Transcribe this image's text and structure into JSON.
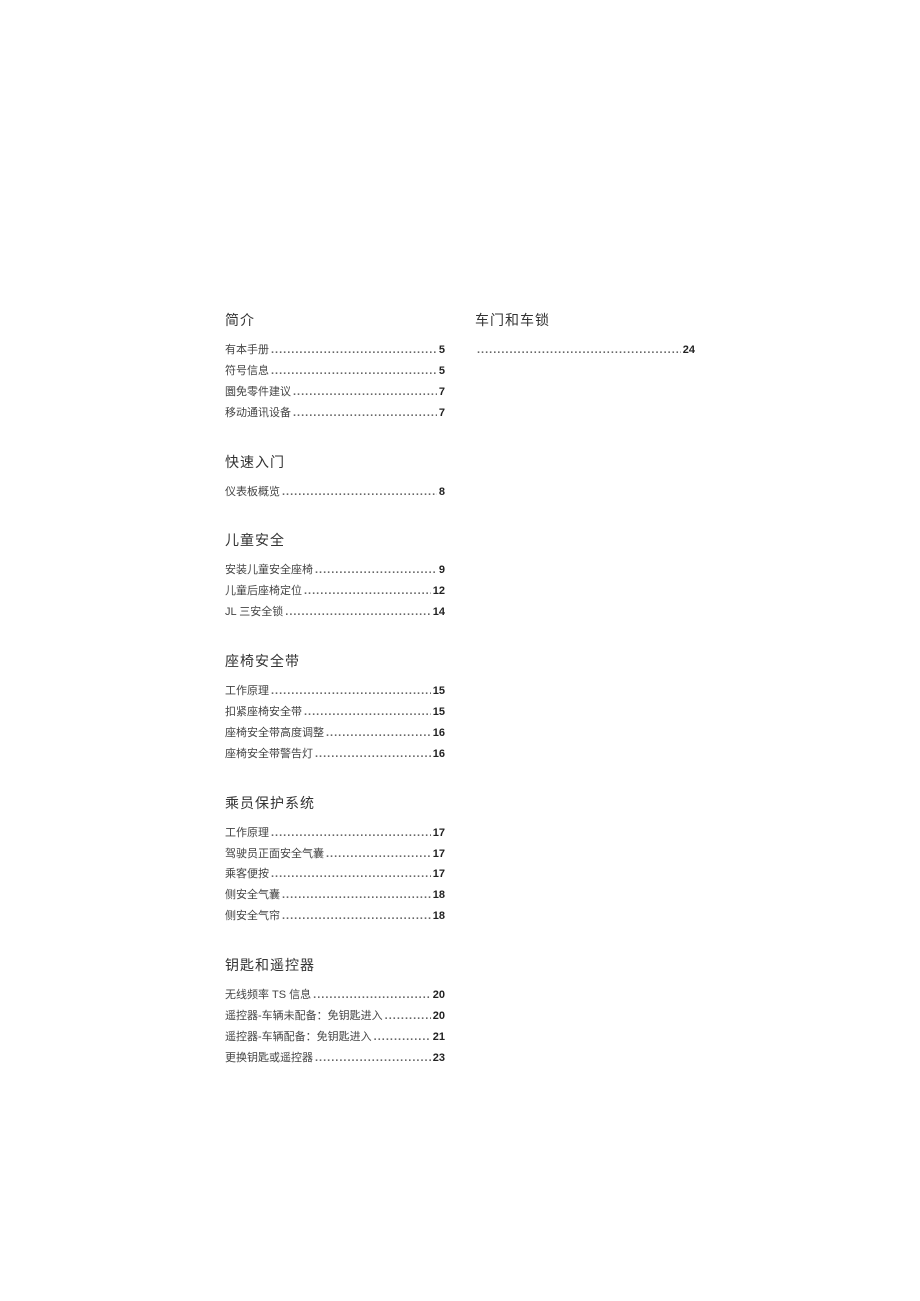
{
  "left_column": [
    {
      "title": "简介",
      "entries": [
        {
          "label": "有本手册",
          "page": "5"
        },
        {
          "label": "符号信息",
          "page": "5"
        },
        {
          "label": "圜免零件建议",
          "page": "7"
        },
        {
          "label": "移动通讯设备",
          "page": "7"
        }
      ]
    },
    {
      "title": "快速入门",
      "entries": [
        {
          "label": "仪表板概览",
          "page": "8"
        }
      ]
    },
    {
      "title": "儿童安全",
      "entries": [
        {
          "label": "安装儿童安全座椅",
          "page": "9"
        },
        {
          "label": "儿童后座椅定位",
          "page": "12"
        },
        {
          "label": "JL 三安全锁",
          "page": "14"
        }
      ]
    },
    {
      "title": "座椅安全带",
      "entries": [
        {
          "label": "工作原理",
          "page": "15"
        },
        {
          "label": "扣紧座椅安全带",
          "page": "15"
        },
        {
          "label": "座椅安全带高度调整",
          "page": "16"
        },
        {
          "label": "座椅安全带警告灯",
          "page": "16"
        }
      ]
    },
    {
      "title": "乘员保护系统",
      "entries": [
        {
          "label": "工作原理",
          "page": "17"
        },
        {
          "label": "驾驶员正面安全气囊",
          "page": "17"
        },
        {
          "label": "乘客便按",
          "page": "17"
        },
        {
          "label": "侧安全气囊",
          "page": "18"
        },
        {
          "label": "侧安全气帘",
          "page": "18"
        }
      ]
    },
    {
      "title": "钥匙和遥控器",
      "entries": [
        {
          "label": "无线频率 TS 信息",
          "page": "20"
        },
        {
          "label": "遥控器-车辆未配备：免钥匙进入",
          "page": "20"
        },
        {
          "label": "遥控器-车辆配备：免钥匙进入",
          "page": "21"
        },
        {
          "label": "更换钥匙或遥控器",
          "page": "23"
        }
      ]
    }
  ],
  "right_column": [
    {
      "title": "车门和车锁",
      "entries": [
        {
          "label": "",
          "page": "24"
        }
      ]
    }
  ]
}
